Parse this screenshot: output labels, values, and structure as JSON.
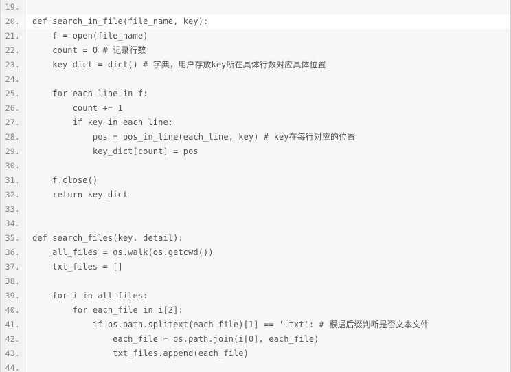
{
  "editor": {
    "language": "python",
    "colors": {
      "background": "#f7f7f7",
      "current_line_background": "#ffffff",
      "gutter_background": "#f2f2f2",
      "gutter_text": "#888888",
      "code_text": "#555555",
      "gutter_border": "#e0e0e0"
    },
    "first_visible_line": 19,
    "last_visible_line": 44,
    "current_line": 20,
    "lines": [
      {
        "number": "19.",
        "text": "",
        "current": false
      },
      {
        "number": "20.",
        "text": "def search_in_file(file_name, key):",
        "current": true
      },
      {
        "number": "21.",
        "text": "    f = open(file_name)",
        "current": false
      },
      {
        "number": "22.",
        "text": "    count = 0 # 记录行数",
        "current": false
      },
      {
        "number": "23.",
        "text": "    key_dict = dict() # 字典，用户存放key所在具体行数对应具体位置",
        "current": false
      },
      {
        "number": "24.",
        "text": "",
        "current": false
      },
      {
        "number": "25.",
        "text": "    for each_line in f:",
        "current": false
      },
      {
        "number": "26.",
        "text": "        count += 1",
        "current": false
      },
      {
        "number": "27.",
        "text": "        if key in each_line:",
        "current": false
      },
      {
        "number": "28.",
        "text": "            pos = pos_in_line(each_line, key) # key在每行对应的位置",
        "current": false
      },
      {
        "number": "29.",
        "text": "            key_dict[count] = pos",
        "current": false
      },
      {
        "number": "30.",
        "text": "",
        "current": false
      },
      {
        "number": "31.",
        "text": "    f.close()",
        "current": false
      },
      {
        "number": "32.",
        "text": "    return key_dict",
        "current": false
      },
      {
        "number": "33.",
        "text": "",
        "current": false
      },
      {
        "number": "34.",
        "text": "",
        "current": false
      },
      {
        "number": "35.",
        "text": "def search_files(key, detail):",
        "current": false
      },
      {
        "number": "36.",
        "text": "    all_files = os.walk(os.getcwd())",
        "current": false
      },
      {
        "number": "37.",
        "text": "    txt_files = []",
        "current": false
      },
      {
        "number": "38.",
        "text": "",
        "current": false
      },
      {
        "number": "39.",
        "text": "    for i in all_files:",
        "current": false
      },
      {
        "number": "40.",
        "text": "        for each_file in i[2]:",
        "current": false
      },
      {
        "number": "41.",
        "text": "            if os.path.splitext(each_file)[1] == '.txt': # 根据后缀判断是否文本文件",
        "current": false
      },
      {
        "number": "42.",
        "text": "                each_file = os.path.join(i[0], each_file)",
        "current": false
      },
      {
        "number": "43.",
        "text": "                txt_files.append(each_file)",
        "current": false
      },
      {
        "number": "44.",
        "text": "",
        "current": false
      }
    ]
  }
}
